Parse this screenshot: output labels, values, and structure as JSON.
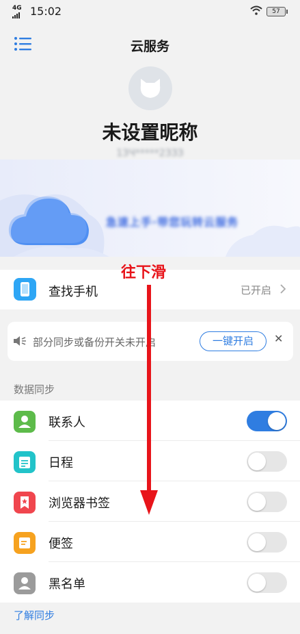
{
  "status_bar": {
    "network": "4G",
    "time": "15:02",
    "battery": "57"
  },
  "header": {
    "title": "云服务"
  },
  "profile": {
    "nickname": "未设置昵称",
    "account": "1ЗЧ*****2ЗЗЗ"
  },
  "banner": {
    "text": "急速上手·带您玩转云服务"
  },
  "annotation": {
    "text": "往下滑"
  },
  "find_phone": {
    "label": "查找手机",
    "status": "已开启"
  },
  "notice": {
    "text": "部分同步或备份开关未开启",
    "button_label": "一键开启"
  },
  "data_sync": {
    "section_title": "数据同步",
    "items": [
      {
        "label": "联系人",
        "icon": "contacts-icon",
        "enabled": true,
        "color": "#5dbb4a"
      },
      {
        "label": "日程",
        "icon": "calendar-icon",
        "enabled": false,
        "color": "#22c3c9"
      },
      {
        "label": "浏览器书签",
        "icon": "bookmark-icon",
        "enabled": false,
        "color": "#f0464e"
      },
      {
        "label": "便签",
        "icon": "note-icon",
        "enabled": false,
        "color": "#f6a21f"
      },
      {
        "label": "黑名单",
        "icon": "blacklist-icon",
        "enabled": false,
        "color": "#9b9b9b"
      }
    ]
  },
  "footer": {
    "learn_sync": "了解同步"
  },
  "colors": {
    "accent": "#2f7de1",
    "annotation": "#e8141a"
  }
}
